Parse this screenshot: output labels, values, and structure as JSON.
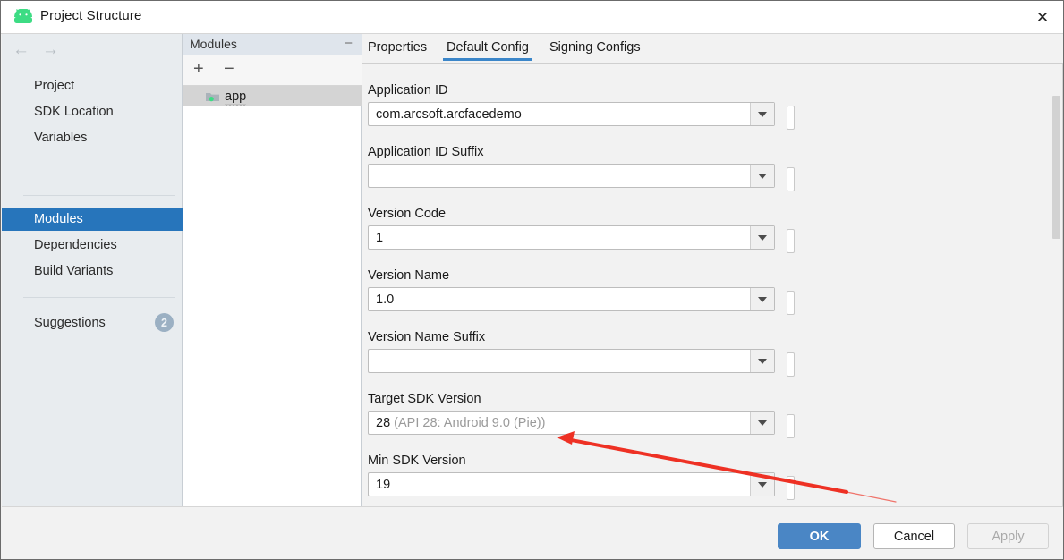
{
  "window": {
    "title": "Project Structure",
    "app_icon": "android-robot-icon",
    "close_label": "✕"
  },
  "nav": {
    "back": "←",
    "forward": "→"
  },
  "sidebar": {
    "items": [
      {
        "label": "Project",
        "selected": false
      },
      {
        "label": "SDK Location",
        "selected": false
      },
      {
        "label": "Variables",
        "selected": false
      },
      {
        "label": "Modules",
        "selected": true
      },
      {
        "label": "Dependencies",
        "selected": false
      },
      {
        "label": "Build Variants",
        "selected": false
      },
      {
        "label": "Suggestions",
        "selected": false
      }
    ],
    "suggestions_badge": "2"
  },
  "modules_panel": {
    "title": "Modules",
    "collapse_label": "−",
    "add_label": "+",
    "remove_label": "−",
    "items": [
      {
        "label": "app",
        "icon": "folder-icon",
        "selected": true
      }
    ]
  },
  "tabs": [
    {
      "label": "Properties",
      "active": false
    },
    {
      "label": "Default Config",
      "active": true
    },
    {
      "label": "Signing Configs",
      "active": false
    }
  ],
  "form": {
    "fields": [
      {
        "label": "Application ID",
        "value": "com.arcsoft.arcfacedemo",
        "hint": ""
      },
      {
        "label": "Application ID Suffix",
        "value": "",
        "hint": ""
      },
      {
        "label": "Version Code",
        "value": "1",
        "hint": ""
      },
      {
        "label": "Version Name",
        "value": "1.0",
        "hint": ""
      },
      {
        "label": "Version Name Suffix",
        "value": "",
        "hint": ""
      },
      {
        "label": "Target SDK Version",
        "value": "28",
        "hint": "(API 28: Android 9.0 (Pie))"
      },
      {
        "label": "Min SDK Version",
        "value": "19",
        "hint": ""
      }
    ]
  },
  "footer": {
    "ok_label": "OK",
    "cancel_label": "Cancel",
    "apply_label": "Apply"
  },
  "colors": {
    "accent_blue": "#2775bb",
    "tab_underline": "#3b86c9",
    "primary_button": "#4a86c5",
    "sidebar_bg": "#e8ecef",
    "annotation_red": "#ee3124",
    "android_green": "#3ddc84"
  }
}
